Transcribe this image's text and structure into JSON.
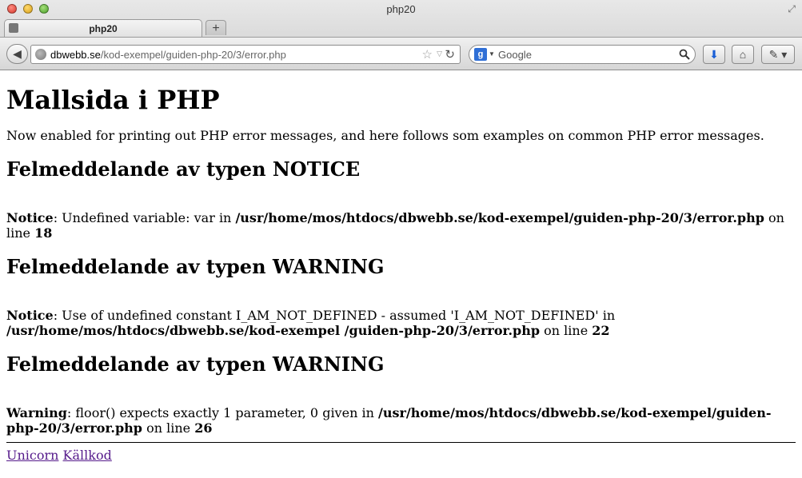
{
  "window": {
    "title": "php20"
  },
  "tab": {
    "label": "php20",
    "new_tab": "+"
  },
  "urlbar": {
    "domain": "dbwebb.se",
    "path": "/kod-exempel/guiden-php-20/3/error.php"
  },
  "search": {
    "placeholder": "Google",
    "engine": "g"
  },
  "icons": {
    "back": "◀",
    "star": "☆",
    "dropdown": "▽",
    "reload": "↻",
    "download": "⬇",
    "home": "⌂",
    "dev": "✎ ▾",
    "resize": "⤢"
  },
  "page": {
    "title": "Mallsida i PHP",
    "intro": "Now enabled for printing out PHP error messages, and here follows som examples on common PHP error messages.",
    "sections": [
      {
        "heading": "Felmeddelande av typen NOTICE",
        "level": "Notice",
        "message": ": Undefined variable: var in ",
        "file": "/usr/home/mos/htdocs/dbwebb.se/kod-exempel/guiden-php-20/3/error.php",
        "on_line": " on line ",
        "line": "18"
      },
      {
        "heading": "Felmeddelande av typen WARNING",
        "level": "Notice",
        "message": ": Use of undefined constant I_AM_NOT_DEFINED - assumed 'I_AM_NOT_DEFINED' in ",
        "file": "/usr/home/mos/htdocs/dbwebb.se/kod-exempel /guiden-php-20/3/error.php",
        "on_line": " on line ",
        "line": "22"
      },
      {
        "heading": "Felmeddelande av typen WARNING",
        "level": "Warning",
        "message": ": floor() expects exactly 1 parameter, 0 given in ",
        "file": "/usr/home/mos/htdocs/dbwebb.se/kod-exempel/guiden-php-20/3/error.php",
        "on_line": " on line ",
        "line": "26"
      }
    ],
    "footer": {
      "link1": "Unicorn",
      "link2": "Källkod"
    }
  }
}
